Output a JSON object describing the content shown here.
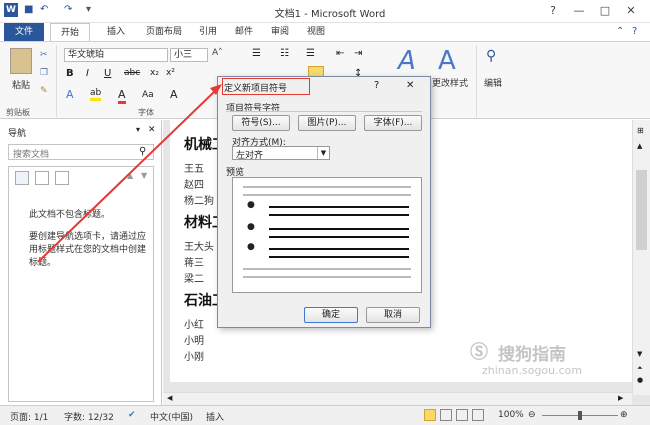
{
  "window": {
    "title": "文档1 - Microsoft Word",
    "controls": [
      "?",
      "—",
      "□",
      "✕"
    ]
  },
  "ribbon_tabs": [
    "文件",
    "开始",
    "插入",
    "页面布局",
    "引用",
    "邮件",
    "审阅",
    "视图"
  ],
  "ribbon": {
    "paste_label": "粘贴",
    "clipboard_group": "剪贴板",
    "font_group": "字体",
    "font_name": "华文琥珀",
    "font_size": "小三",
    "style_change_label": "更改样式",
    "edit_label": "编辑"
  },
  "nav_pane": {
    "title": "导航",
    "search_placeholder": "搜索文档",
    "no_headings": "此文档不包含标题。",
    "hint": "要创建导航选项卡，请通过应用标题样式在您的文档中创建标题。"
  },
  "document": {
    "sections": [
      {
        "heading": "机械工",
        "items": [
          "王五",
          "赵四",
          "杨二狗"
        ]
      },
      {
        "heading": "材料工",
        "items": [
          "王大头",
          "蒋三",
          "梁二"
        ]
      },
      {
        "heading": "石油工",
        "items": [
          "小红",
          "小明",
          "小刚"
        ]
      }
    ]
  },
  "dialog": {
    "title": "定义新项目符号",
    "help": "?",
    "close": "✕",
    "group_label": "项目符号字符",
    "symbol_btn": "符号(S)...",
    "picture_btn": "图片(P)...",
    "font_btn": "字体(F)...",
    "align_label": "对齐方式(M):",
    "align_value": "左对齐",
    "preview_label": "预览",
    "ok_btn": "确定",
    "cancel_btn": "取消"
  },
  "status": {
    "page": "页面: 1/1",
    "words": "字数: 12/32",
    "lang": "中文(中国)",
    "mode": "插入",
    "zoom": "100%"
  },
  "watermark": {
    "name": "搜狗指南",
    "url": "zhinan.sogou.com"
  }
}
